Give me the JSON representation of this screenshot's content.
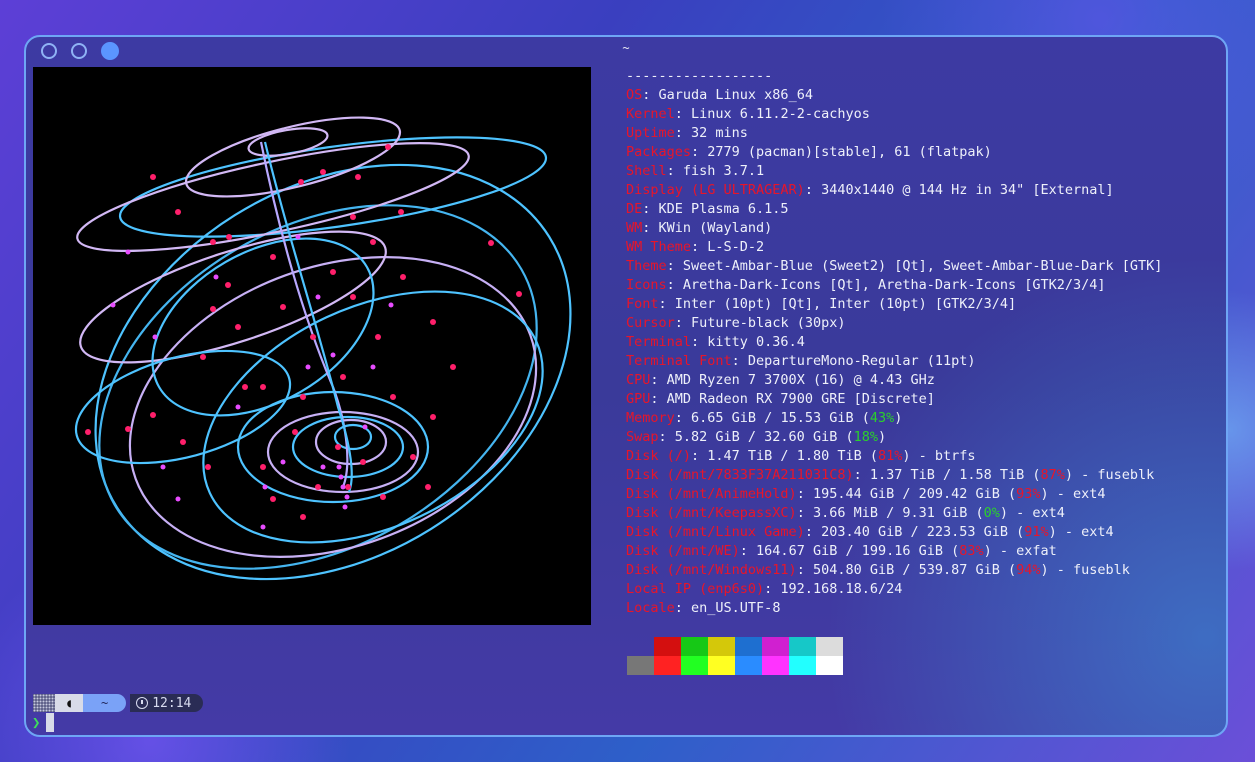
{
  "window": {
    "title": "~"
  },
  "info_rows": [
    {
      "value": "------------------"
    },
    {
      "key": "OS",
      "value": ": Garuda Linux x86_64"
    },
    {
      "key": "Kernel",
      "value": ": Linux 6.11.2-2-cachyos"
    },
    {
      "key": "Uptime",
      "value": ": 32 mins"
    },
    {
      "key": "Packages",
      "value": ": 2779 (pacman)[stable], 61 (flatpak)"
    },
    {
      "key": "Shell",
      "value": ": fish 3.7.1"
    },
    {
      "key": "Display (LG ULTRAGEAR)",
      "value": ": 3440x1440 @ 144 Hz in 34\" [External]"
    },
    {
      "key": "DE",
      "value": ": KDE Plasma 6.1.5"
    },
    {
      "key": "WM",
      "value": ": KWin (Wayland)"
    },
    {
      "key": "WM Theme",
      "value": ": L-S-D-2"
    },
    {
      "key": "Theme",
      "value": ": Sweet-Ambar-Blue (Sweet2) [Qt], Sweet-Ambar-Blue-Dark [GTK]"
    },
    {
      "key": "Icons",
      "value": ": Aretha-Dark-Icons [Qt], Aretha-Dark-Icons [GTK2/3/4]"
    },
    {
      "key": "Font",
      "value": ": Inter (10pt) [Qt], Inter (10pt) [GTK2/3/4]"
    },
    {
      "key": "Cursor",
      "value": ": Future-black (30px)"
    },
    {
      "key": "Terminal",
      "value": ": kitty 0.36.4"
    },
    {
      "key": "Terminal Font",
      "value": ": DepartureMono-Regular (11pt)"
    },
    {
      "key": "CPU",
      "value": ": AMD Ryzen 7 3700X (16) @ 4.43 GHz"
    },
    {
      "key": "GPU",
      "value": ": AMD Radeon RX 7900 GRE [Discrete]"
    },
    {
      "key": "Memory",
      "value": ": 6.65 GiB / 15.53 GiB (",
      "pct": "43%",
      "pct_color": "green",
      "tail": ")"
    },
    {
      "key": "Swap",
      "value": ": 5.82 GiB / 32.60 GiB (",
      "pct": "18%",
      "pct_color": "green",
      "tail": ")"
    },
    {
      "key": "Disk (/)",
      "value": ": 1.47 TiB / 1.80 TiB (",
      "pct": "81%",
      "pct_color": "red",
      "tail": ") - btrfs"
    },
    {
      "key": "Disk (/mnt/7833F37A211031C8)",
      "value": ": 1.37 TiB / 1.58 TiB (",
      "pct": "87%",
      "pct_color": "red",
      "tail": ") - fuseblk"
    },
    {
      "key": "Disk (/mnt/AnimeHold)",
      "value": ": 195.44 GiB / 209.42 GiB (",
      "pct": "93%",
      "pct_color": "red",
      "tail": ") - ext4"
    },
    {
      "key": "Disk (/mnt/KeepassXC)",
      "value": ": 3.66 MiB / 9.31 GiB (",
      "pct": "0%",
      "pct_color": "green",
      "tail": ") - ext4"
    },
    {
      "key": "Disk (/mnt/Linux Game)",
      "value": ": 203.40 GiB / 223.53 GiB (",
      "pct": "91%",
      "pct_color": "red",
      "tail": ") - ext4"
    },
    {
      "key": "Disk (/mnt/WE)",
      "value": ": 164.67 GiB / 199.16 GiB (",
      "pct": "83%",
      "pct_color": "red",
      "tail": ") - exfat"
    },
    {
      "key": "Disk (/mnt/Windows11)",
      "value": ": 504.80 GiB / 539.87 GiB (",
      "pct": "94%",
      "pct_color": "red",
      "tail": ") - fuseblk"
    },
    {
      "key": "Local IP (enp6s0)",
      "value": ": 192.168.18.6/24"
    },
    {
      "key": "Locale",
      "value": ": en_US.UTF-8"
    }
  ],
  "palette": {
    "top": [
      "transparent",
      "#d40f0f",
      "#16c816",
      "#d4c80a",
      "#1e6fd0",
      "#d020d0",
      "#16c8c8",
      "#dcdcdc"
    ],
    "bottom": [
      "#777777",
      "#ff2222",
      "#22ff22",
      "#ffff22",
      "#2a8cff",
      "#ff33ff",
      "#22ffff",
      "#ffffff"
    ]
  },
  "prompt": {
    "fish_icon": "fish-icon",
    "dir": "~",
    "time": "12:14",
    "chevron": "❯"
  },
  "colors": {
    "key": "#e8152a",
    "text": "#eef0fa",
    "pct_green": "#2bd12b",
    "pct_red": "#e8152a",
    "accent": "#6ea6f5"
  }
}
